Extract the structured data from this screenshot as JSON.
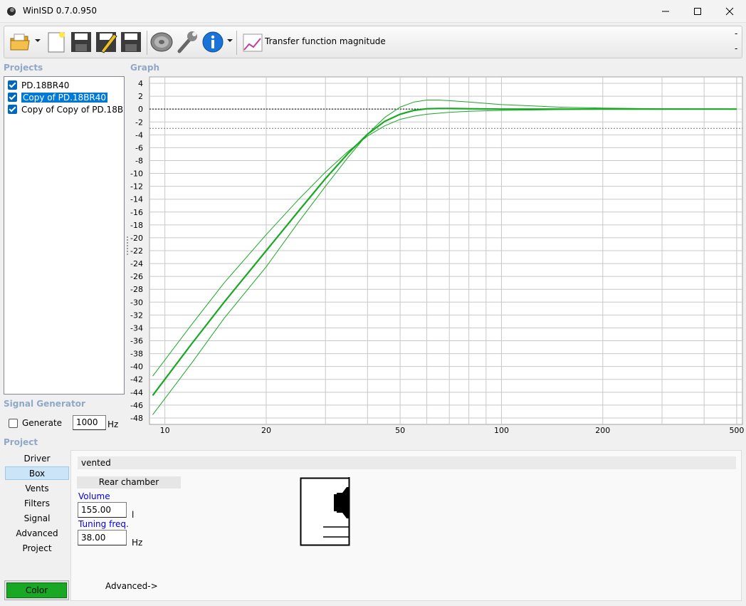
{
  "window": {
    "title": "WinISD 0.7.0.950"
  },
  "toolbar": {
    "icons": [
      "open-folder-icon",
      "new-document-icon",
      "save-icon",
      "edit-save-icon",
      "save-all-icon",
      "speaker-icon",
      "wrench-icon",
      "info-icon"
    ],
    "graph_type_label": "Transfer function magnitude",
    "right_dashes": [
      "-",
      "-"
    ]
  },
  "projects": {
    "label": "Projects",
    "items": [
      {
        "name": "PD.18BR40",
        "checked": true,
        "selected": false
      },
      {
        "name": "Copy of PD.18BR40",
        "checked": true,
        "selected": true
      },
      {
        "name": "Copy of Copy of PD.18BR40",
        "checked": true,
        "selected": false
      }
    ]
  },
  "graph": {
    "label": "Graph"
  },
  "signal_generator": {
    "label": "Signal Generator",
    "generate_label": "Generate",
    "generate_checked": false,
    "frequency_value": "1000",
    "frequency_unit": "Hz"
  },
  "project": {
    "label": "Project",
    "nav": [
      "Driver",
      "Box",
      "Vents",
      "Filters",
      "Signal",
      "Advanced",
      "Project"
    ],
    "active_nav": "Box",
    "color_button_label": "Color",
    "color": "#18a823"
  },
  "box": {
    "type": "vented",
    "chamber_label": "Rear chamber",
    "volume_label": "Volume",
    "volume_value": "155.00",
    "volume_unit": "l",
    "tuning_label": "Tuning freq.",
    "tuning_value": "38.00",
    "tuning_unit": "Hz",
    "advanced_link": "Advanced->"
  },
  "chart_data": {
    "type": "line",
    "title": "Transfer function magnitude",
    "x_scale": "log",
    "xlim": [
      9,
      520
    ],
    "ylim": [
      -49,
      5
    ],
    "x_ticks": [
      10,
      20,
      50,
      100,
      200,
      500
    ],
    "x_tick_labels": [
      "10",
      "20",
      "50",
      "100",
      "200",
      "500"
    ],
    "y_ticks": [
      4,
      2,
      0,
      -2,
      -4,
      -6,
      -8,
      -10,
      -12,
      -14,
      -16,
      -18,
      -20,
      -22,
      -24,
      -26,
      -28,
      -30,
      -32,
      -34,
      -36,
      -38,
      -40,
      -42,
      -44,
      -46,
      -48
    ],
    "grid": true,
    "reference_lines": [
      0,
      -3
    ],
    "series": [
      {
        "x": [
          9.2,
          12,
          15,
          20,
          25,
          30,
          35,
          40,
          45,
          50,
          55,
          60,
          65,
          70,
          80,
          100,
          150,
          200,
          300,
          500
        ],
        "y": [
          -44.5,
          -36.5,
          -30,
          -22,
          -15.8,
          -10.8,
          -6.9,
          -3.9,
          -1.9,
          -0.8,
          -0.2,
          0.05,
          0.1,
          0.1,
          0.05,
          0,
          0,
          0,
          0,
          0
        ]
      },
      {
        "x": [
          9.2,
          12,
          15,
          20,
          25,
          30,
          35,
          40,
          45,
          50,
          55,
          60,
          70,
          80,
          100,
          150,
          200,
          300,
          500
        ],
        "y": [
          -41.5,
          -33.5,
          -27,
          -19.5,
          -14,
          -9.8,
          -6.6,
          -4.2,
          -2.6,
          -1.6,
          -1.1,
          -0.8,
          -0.5,
          -0.35,
          -0.2,
          -0.08,
          -0.04,
          -0.02,
          0
        ]
      },
      {
        "x": [
          9.2,
          12,
          15,
          20,
          25,
          30,
          35,
          40,
          45,
          50,
          55,
          60,
          65,
          70,
          80,
          100,
          150,
          200,
          300,
          500
        ],
        "y": [
          -47.5,
          -39.5,
          -32.5,
          -24.5,
          -17.5,
          -12,
          -7.5,
          -3.9,
          -1.3,
          0.3,
          1.1,
          1.4,
          1.4,
          1.3,
          1.1,
          0.7,
          0.3,
          0.15,
          0.05,
          0
        ]
      }
    ]
  }
}
